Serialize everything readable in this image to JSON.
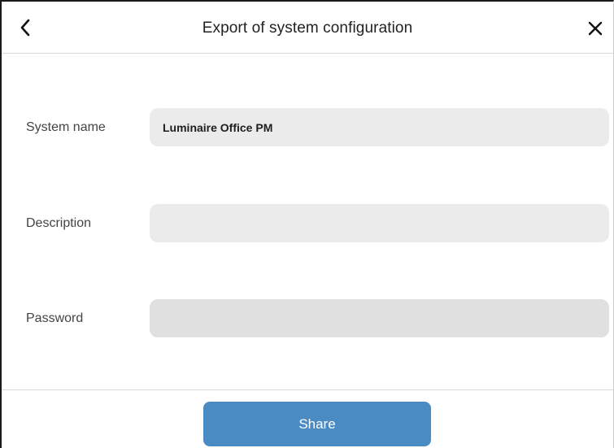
{
  "header": {
    "title": "Export of system configuration",
    "back_icon": "chevron-left-icon",
    "close_icon": "close-icon"
  },
  "form": {
    "system_name": {
      "label": "System name",
      "value": "Luminaire Office PM"
    },
    "description": {
      "label": "Description",
      "value": ""
    },
    "password": {
      "label": "Password",
      "value": ""
    }
  },
  "footer": {
    "share_label": "Share",
    "share_color": "#4a8bc4"
  }
}
